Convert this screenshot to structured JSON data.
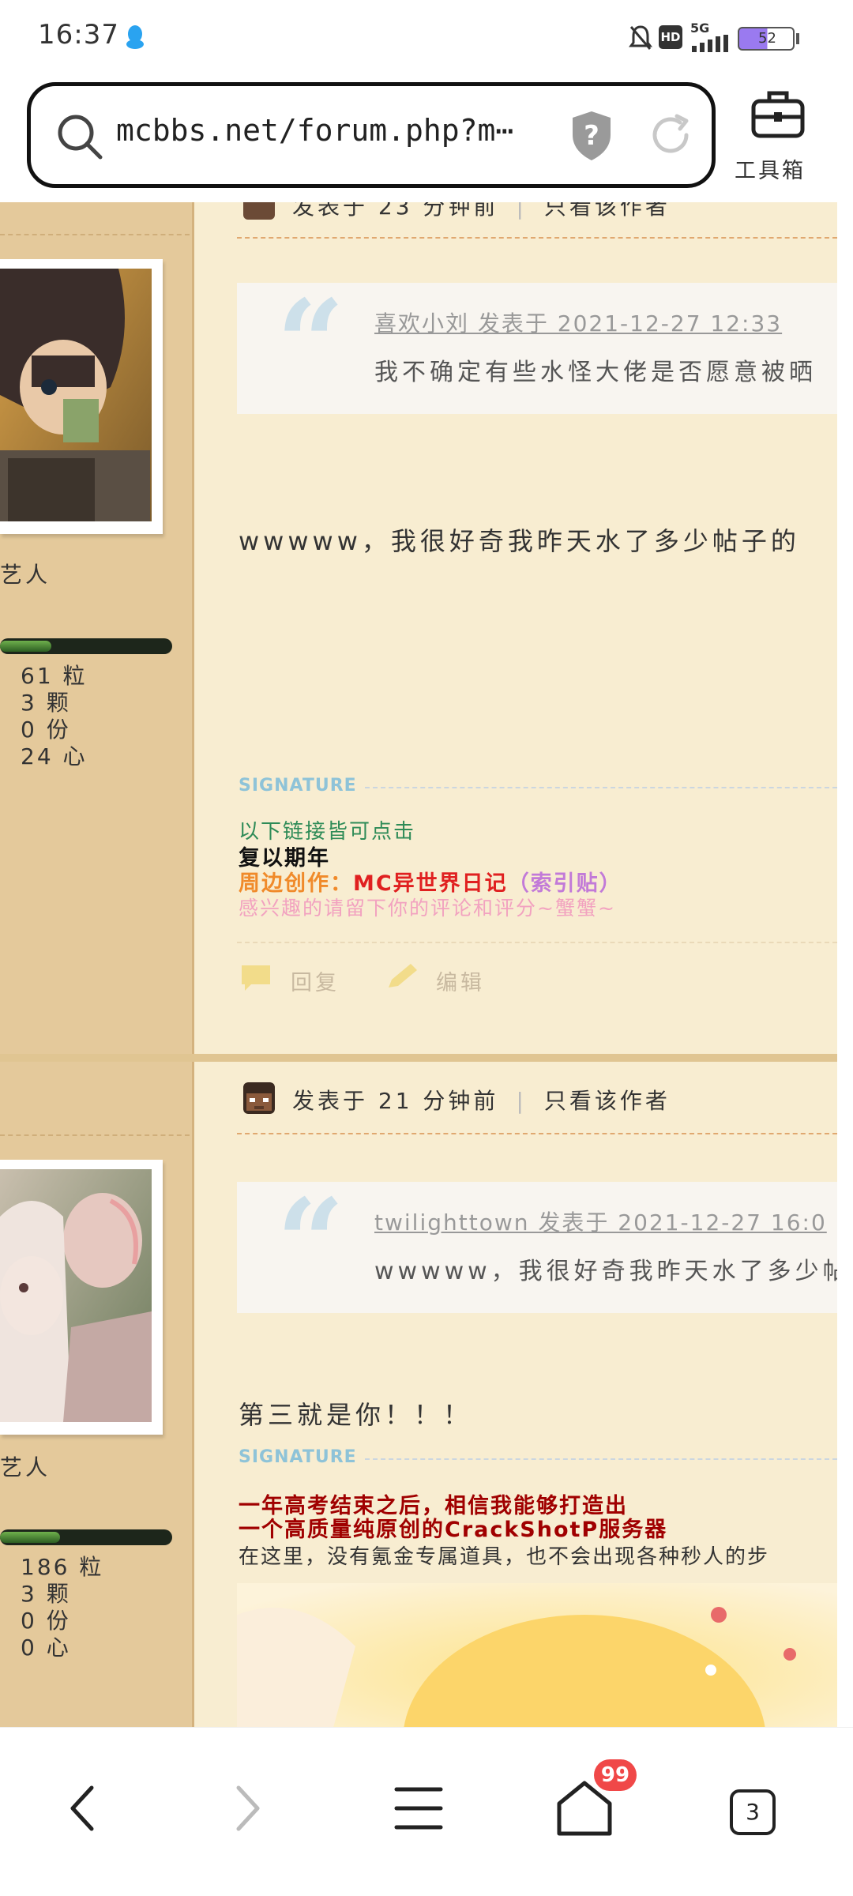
{
  "status_bar": {
    "time": "16:37",
    "network": "5G",
    "hd": "HD",
    "battery": "52"
  },
  "browser": {
    "url": "mcbbs.net/forum.php?m⋯",
    "toolbox_label": "工具箱",
    "tab_count": "3",
    "home_badge": "99"
  },
  "posts": [
    {
      "meta": {
        "prefix": "发表于 23 分钟前",
        "author_only": "只看该作者"
      },
      "sidebar": {
        "rank": "艺人",
        "exp_level": 0.3,
        "stats": [
          "61 粒",
          "3 颗",
          "0 份",
          "24 心"
        ]
      },
      "quote": {
        "author_line": "喜欢小刘 发表于 2021-12-27 12:33",
        "text": "我不确定有些水怪大佬是否愿意被晒"
      },
      "body": "wwwww，我很好奇我昨天水了多少帖子的",
      "signature_label": "SIGNATURE",
      "signature": [
        {
          "text": "以下链接皆可点击",
          "color": "#2e8b57"
        },
        {
          "text": "复以期年",
          "color": "#111111"
        },
        {
          "text": "周边创作：",
          "color": "#f08a2a"
        },
        {
          "text": "MC异世界日记",
          "color": "#e02020"
        },
        {
          "text": "（索引贴）",
          "color": "#c27ad8"
        },
        {
          "text": "感兴趣的请留下你的评论和评分~蟹蟹~",
          "color": "#f2a2c0"
        }
      ],
      "actions": {
        "reply": "回复",
        "edit": "编辑"
      }
    },
    {
      "meta": {
        "prefix": "发表于 21 分钟前",
        "author_only": "只看该作者"
      },
      "sidebar": {
        "rank": "艺人",
        "exp_level": 0.35,
        "stats": [
          "186 粒",
          "3 颗",
          "0 份",
          "0 心"
        ]
      },
      "quote": {
        "author_line": "twilighttown 发表于 2021-12-27 16:0",
        "text": "wwwww，我很好奇我昨天水了多少帖"
      },
      "body": "第三就是你！！！",
      "signature_label": "SIGNATURE",
      "signature": [
        {
          "text": "一年高考结束之后，相信我能够打造出",
          "color": "#a00000"
        },
        {
          "text": "一个高质量纯原创的CrackShotP服务器",
          "color": "#a00000"
        },
        {
          "text": "在这里，没有氪金专属道具，也不会出现各种秒人的步",
          "color": "#333333"
        }
      ]
    }
  ]
}
